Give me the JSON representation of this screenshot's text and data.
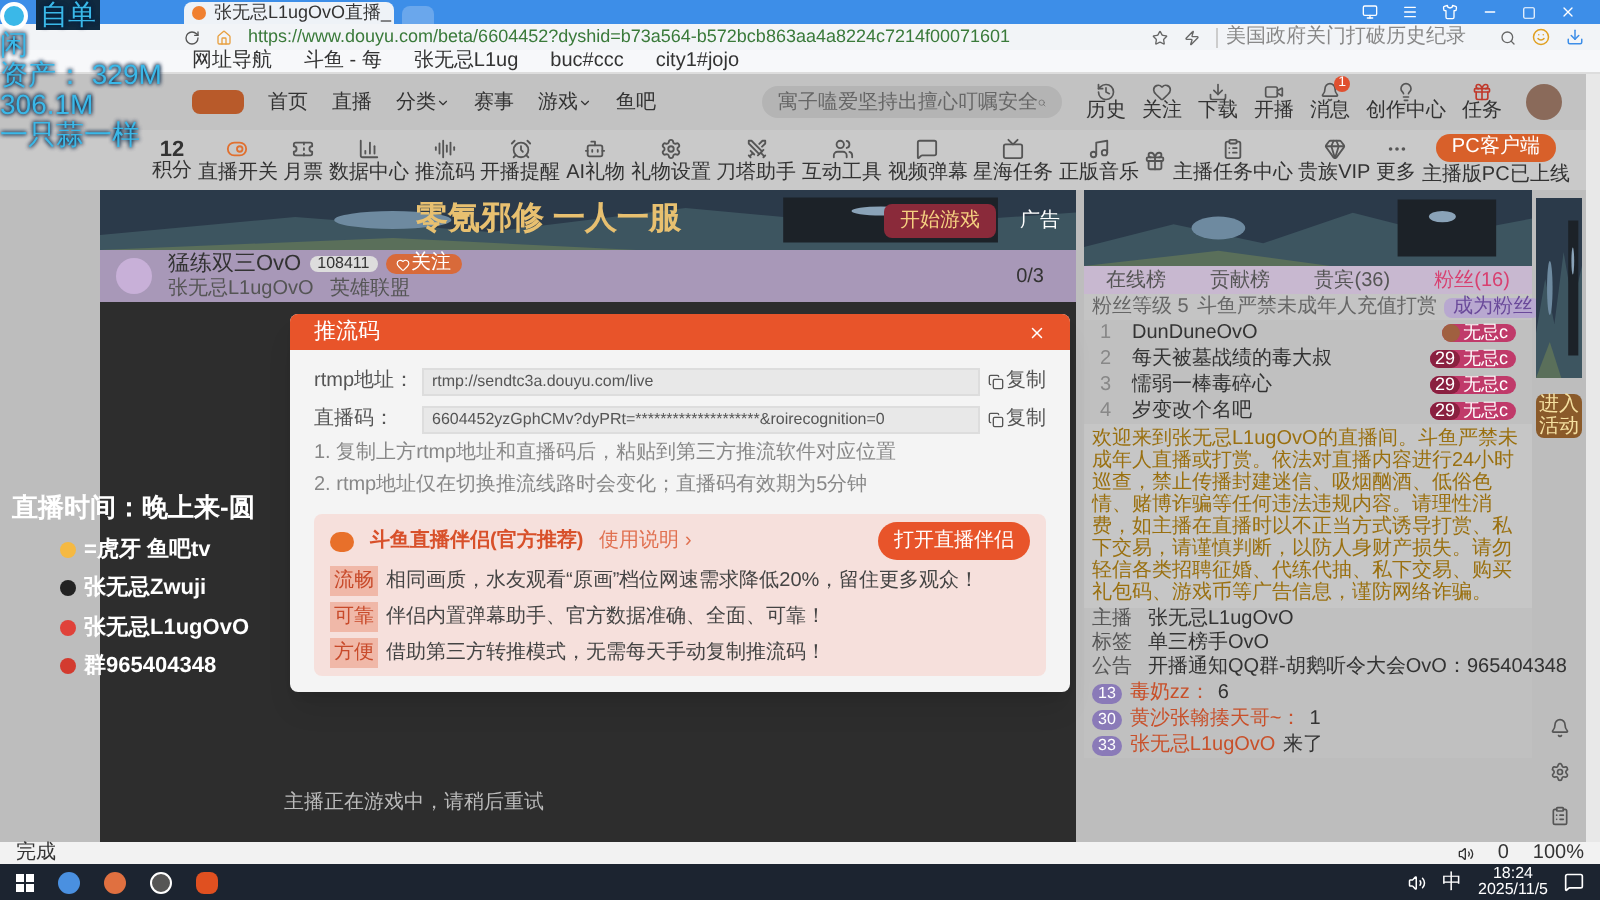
{
  "browser": {
    "tab_title": "张无忌L1ugOvO直播_",
    "url": "https://www.douyu.com/beta/6604452?dyshid=b73a564-b572bcb863aa4a8224c7214f00071601",
    "search_hint": "美国政府关门打破历史纪录",
    "bookmarks": [
      "网址导航",
      "斗鱼 - 每",
      "张无忌L1ug",
      "buc#ccc",
      "city1#jojo"
    ]
  },
  "site_nav": {
    "items": [
      {
        "label": "首页",
        "dropdown": false
      },
      {
        "label": "直播",
        "dropdown": false
      },
      {
        "label": "分类",
        "dropdown": true
      },
      {
        "label": "赛事",
        "dropdown": false
      },
      {
        "label": "游戏",
        "dropdown": true
      },
      {
        "label": "鱼吧",
        "dropdown": false
      }
    ],
    "search_placeholder": "寓子嗑爱坚持出擅心叮嘱安全",
    "actions": [
      {
        "kind": "history",
        "label": "历史"
      },
      {
        "kind": "follow",
        "label": "关注"
      },
      {
        "kind": "download",
        "label": "下载"
      },
      {
        "kind": "broadcast",
        "label": "开播"
      },
      {
        "kind": "message",
        "label": "消息",
        "badge": "1"
      },
      {
        "kind": "creator",
        "label": "创作中心"
      },
      {
        "kind": "task",
        "label": "任务"
      }
    ]
  },
  "toolbar": {
    "points": "12",
    "points_label": "积分",
    "tools": [
      {
        "kind": "switch",
        "label": "直播开关"
      },
      {
        "kind": "ticket",
        "label": "月票"
      },
      {
        "kind": "data",
        "label": "数据中心"
      },
      {
        "kind": "wave",
        "label": "推流码"
      },
      {
        "kind": "alarm",
        "label": "开播提醒"
      },
      {
        "kind": "ai",
        "label": "AI礼物"
      },
      {
        "kind": "gift-set",
        "label": "礼物设置"
      },
      {
        "kind": "helper",
        "label": "刀塔助手"
      },
      {
        "kind": "interact",
        "label": "互动工具"
      },
      {
        "kind": "danmaku",
        "label": "视频弹幕"
      },
      {
        "kind": "ad",
        "label": "星海任务"
      },
      {
        "kind": "music",
        "label": "正版音乐"
      },
      {
        "kind": "gift"
      },
      {
        "kind": "clipboard",
        "label": "主播任务中心"
      },
      {
        "kind": "diamond",
        "label": "贵族VIP"
      },
      {
        "kind": "more",
        "label": "更多"
      }
    ],
    "pc_button": "PC客户端",
    "pc_note": "主播版PC已上线"
  },
  "banner": {
    "title": "零氪邪修 一人一服",
    "button": "开始游戏",
    "ad": "广告"
  },
  "streamer": {
    "name": "猛练双三OvO",
    "count": "108411",
    "follow": "关注",
    "sub": "张无忌L1ugOvO",
    "game": "英雄联盟",
    "task": "0/3"
  },
  "player_message": "主播正在游戏中，请稍后重试",
  "modal": {
    "title": "推流码",
    "fields": [
      {
        "label": "rtmp地址：",
        "value": "rtmp://sendtc3a.douyu.com/live",
        "copy": "复制"
      },
      {
        "label": "直播码：",
        "value": "6604452yzGphCMv?dyPRt=********************&roirecognition=0",
        "copy": "复制"
      }
    ],
    "notes": [
      "1. 复制上方rtmp地址和直播码后，粘贴到第三方推流软件对应位置",
      "2. rtmp地址仅在切换推流线路时会变化；直播码有效期为5分钟"
    ],
    "promo": {
      "title": "斗鱼直播伴侣(官方推荐)",
      "help": "使用说明 ›",
      "button": "打开直播伴侣",
      "rows": [
        {
          "tag": "流畅",
          "text": "相同画质，水友观看“原画”档位网速需求降低20%，留住更多观众！"
        },
        {
          "tag": "可靠",
          "text": "伴侣内置弹幕助手、官方数据准确、全面、可靠！"
        },
        {
          "tag": "方便",
          "text": "借助第三方转推模式，无需每天手动复制推流码！"
        }
      ]
    }
  },
  "side": {
    "tabs": [
      {
        "label": "在线榜",
        "selected": false
      },
      {
        "label": "贡献榜",
        "selected": false
      },
      {
        "label": "贵宾(36)",
        "selected": false
      },
      {
        "label": "粉丝(16)",
        "selected": true
      }
    ],
    "fan_level": "粉丝等级 5",
    "fan_notice": "斗鱼严禁未成年人充值打赏",
    "fan_button": "成为粉丝",
    "fans": [
      {
        "rank": "1",
        "name": "DunDuneOvO",
        "badge": "无忌c"
      },
      {
        "rank": "2",
        "name": "每天被墓战绩的毒大叔",
        "level": "29",
        "badge": "无忌c"
      },
      {
        "rank": "3",
        "name": "懦弱一棒毒碎心",
        "level": "29",
        "badge": "无忌c"
      },
      {
        "rank": "4",
        "name": "岁变改个名吧",
        "level": "29",
        "badge": "无忌c"
      }
    ],
    "notice": "欢迎来到张无忌L1ugOvO的直播间。斗鱼严禁未成年人直播或打赏。依法对直播内容进行24小时巡查，禁止传播封建迷信、吸烟酗酒、低俗色情、赌博诈骗等任何违法违规内容。请理性消费，如主播在直播时以不正当方式诱导打赏、私下交易，请谨慎判断，以防人身财产损失。请勿轻信各类招聘征婚、代练代抽、私下交易、购买礼包码、游戏币等广告信息，谨防网络诈骗。",
    "info": [
      {
        "label": "主播",
        "value": "张无忌L1ugOvO"
      },
      {
        "label": "标签",
        "value": "单三榜手OvO"
      },
      {
        "label": "公告",
        "value": "开播通知QQ群-胡鹅听令大会OvO：965404348"
      }
    ],
    "chat": [
      {
        "level": "13",
        "name": "毒奶zz：",
        "text": "6"
      },
      {
        "level": "30",
        "name": "黄沙张翰揍天哥~：",
        "text": "1"
      },
      {
        "level": "33",
        "name": "张无忌L1ugOvO",
        "text": "来了"
      }
    ],
    "ad_link": "进入活动"
  },
  "status_bar": {
    "text": "完成",
    "count": "0",
    "zoom": "100%"
  },
  "taskbar": {
    "ime": "中",
    "time": "18:24",
    "date": "2025/11/5"
  },
  "overlay": {
    "stats": [
      "自单",
      "闲",
      "资产： 329M",
      "306.1M",
      "一只蒜一样"
    ],
    "stream_time": "直播时间：晚上来-圆",
    "socials": [
      {
        "kind": "huya",
        "text": "=虎牙 鱼吧tv"
      },
      {
        "kind": "douyin",
        "text": "张无忌Zwuji"
      },
      {
        "kind": "weibo",
        "text": "张无忌L1ugOvO"
      },
      {
        "kind": "qq",
        "text": "群965404348"
      }
    ]
  }
}
